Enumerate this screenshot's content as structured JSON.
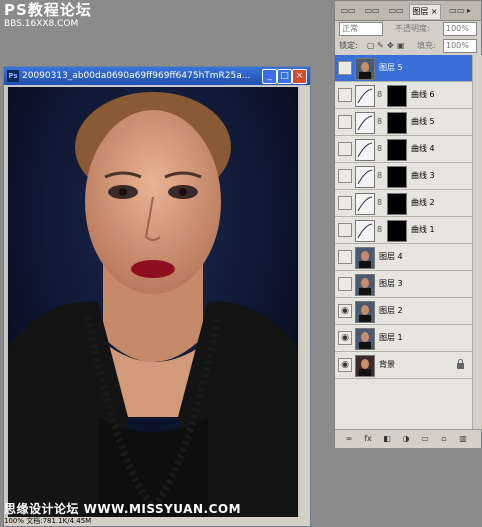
{
  "watermarks": {
    "top_line1": "PS教程论坛",
    "top_line2": "BBS.16XX8.COM",
    "bottom": "思缘设计论坛 WWW.MISSYUAN.COM"
  },
  "document": {
    "title": "20090313_ab00da0690a69ff969ff6475hTmR25a...",
    "app_badge": "Ps",
    "status": "100%   文档:781.1K/4.45M"
  },
  "panel": {
    "tabs": [
      "图层"
    ],
    "close_glyph": "×",
    "blend_mode": "正常",
    "opacity_label": "不透明度:",
    "opacity_value": "100%",
    "lock_label": "锁定:",
    "fill_label": "填充:",
    "fill_value": "100%",
    "layers": [
      {
        "name": "图层 5",
        "selected": true,
        "visible": false,
        "type": "normal"
      },
      {
        "name": "曲线 6",
        "selected": false,
        "visible": false,
        "type": "curves"
      },
      {
        "name": "曲线 5",
        "selected": false,
        "visible": false,
        "type": "curves"
      },
      {
        "name": "曲线 4",
        "selected": false,
        "visible": false,
        "type": "curves"
      },
      {
        "name": "曲线 3",
        "selected": false,
        "visible": false,
        "type": "curves"
      },
      {
        "name": "曲线 2",
        "selected": false,
        "visible": false,
        "type": "curves"
      },
      {
        "name": "曲线 1",
        "selected": false,
        "visible": false,
        "type": "curves"
      },
      {
        "name": "图层 4",
        "selected": false,
        "visible": false,
        "type": "normal"
      },
      {
        "name": "图层 3",
        "selected": false,
        "visible": false,
        "type": "normal"
      },
      {
        "name": "图层 2",
        "selected": false,
        "visible": true,
        "type": "normal"
      },
      {
        "name": "图层 1",
        "selected": false,
        "visible": true,
        "type": "normal"
      },
      {
        "name": "背景",
        "selected": false,
        "visible": true,
        "type": "background"
      }
    ],
    "footer_icons": [
      "link-icon",
      "fx-icon",
      "mask-icon",
      "adjustment-icon",
      "group-icon",
      "new-layer-icon",
      "trash-icon"
    ]
  },
  "colors": {
    "title_bar": "#2a5fc8",
    "selected_layer": "#3a6fd8",
    "workspace": "#8b8b8b"
  }
}
